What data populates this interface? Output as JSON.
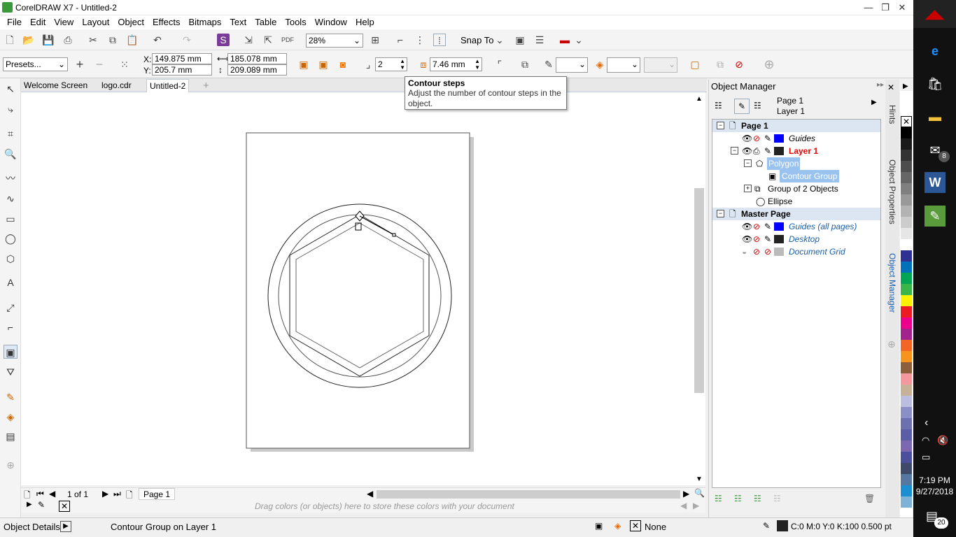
{
  "app": {
    "title": "CorelDRAW X7 - Untitled-2"
  },
  "menu": [
    "File",
    "Edit",
    "View",
    "Layout",
    "Object",
    "Effects",
    "Bitmaps",
    "Text",
    "Table",
    "Tools",
    "Window",
    "Help"
  ],
  "toolbar": {
    "zoom": "28%",
    "snap_to": "Snap To"
  },
  "property_bar": {
    "presets": "Presets...",
    "x_label": "X:",
    "x_value": "149.875 mm",
    "y_label": "Y:",
    "y_value": "205.7 mm",
    "width": "185.078 mm",
    "height": "209.089 mm",
    "steps": "2",
    "offset": "7.46 mm"
  },
  "tooltip": {
    "title": "Contour steps",
    "body": "Adjust the number of contour steps in the object."
  },
  "doc_tabs": [
    "Welcome Screen",
    "logo.cdr",
    "Untitled-2"
  ],
  "active_tab": "Untitled-2",
  "page_nav": {
    "counter": "1 of 1",
    "page_tab": "Page 1"
  },
  "palette_hint": "Drag colors (or objects) here to store these colors with your document",
  "object_manager": {
    "title": "Object Manager",
    "current_page": "Page 1",
    "current_layer": "Layer 1",
    "rows": [
      {
        "label": "Page 1",
        "kind": "page"
      },
      {
        "label": "Guides",
        "kind": "layer",
        "color": "#0000ff"
      },
      {
        "label": "Layer 1",
        "kind": "layer-active",
        "color": "#222222"
      },
      {
        "label": "Polygon",
        "kind": "object-selected"
      },
      {
        "label": "Contour Group",
        "kind": "object-selected"
      },
      {
        "label": "Group of 2 Objects",
        "kind": "object"
      },
      {
        "label": "Ellipse",
        "kind": "object"
      },
      {
        "label": "Master Page",
        "kind": "page"
      },
      {
        "label": "Guides (all pages)",
        "kind": "master-layer",
        "color": "#0000ff"
      },
      {
        "label": "Desktop",
        "kind": "master-layer",
        "color": "#222222"
      },
      {
        "label": "Document Grid",
        "kind": "master-layer",
        "color": "#bbbbbb"
      }
    ]
  },
  "side_tabs": [
    "Hints",
    "Object Properties",
    "Object Manager"
  ],
  "status": {
    "object_details": "Object Details",
    "selection": "Contour Group on Layer 1",
    "fill": "None",
    "outline": "C:0 M:0 Y:0 K:100  0.500 pt"
  },
  "palette_colors": [
    "#ffffff",
    "#000000",
    "#1a1a1a",
    "#333333",
    "#4d4d4d",
    "#666666",
    "#808080",
    "#999999",
    "#b3b3b3",
    "#cccccc",
    "#e6e6e6",
    "#ffffff",
    "#2e3192",
    "#0072bc",
    "#00a651",
    "#39b54a",
    "#fff200",
    "#ed1c24",
    "#ec008c",
    "#a3238e",
    "#f26522",
    "#f7941d",
    "#8b5e3c",
    "#f5989d",
    "#c7b299",
    "#bcbee0",
    "#8c8fc6",
    "#6d6faf",
    "#5b5ea6",
    "#7b68b0",
    "#4b4f9c",
    "#3f4a6b",
    "#5577a0",
    "#1b8fd1",
    "#7fb3d5"
  ],
  "taskbar": {
    "time": "7:19 PM",
    "date": "9/27/2018",
    "mail_badge": "8",
    "notif_badge": "20"
  }
}
